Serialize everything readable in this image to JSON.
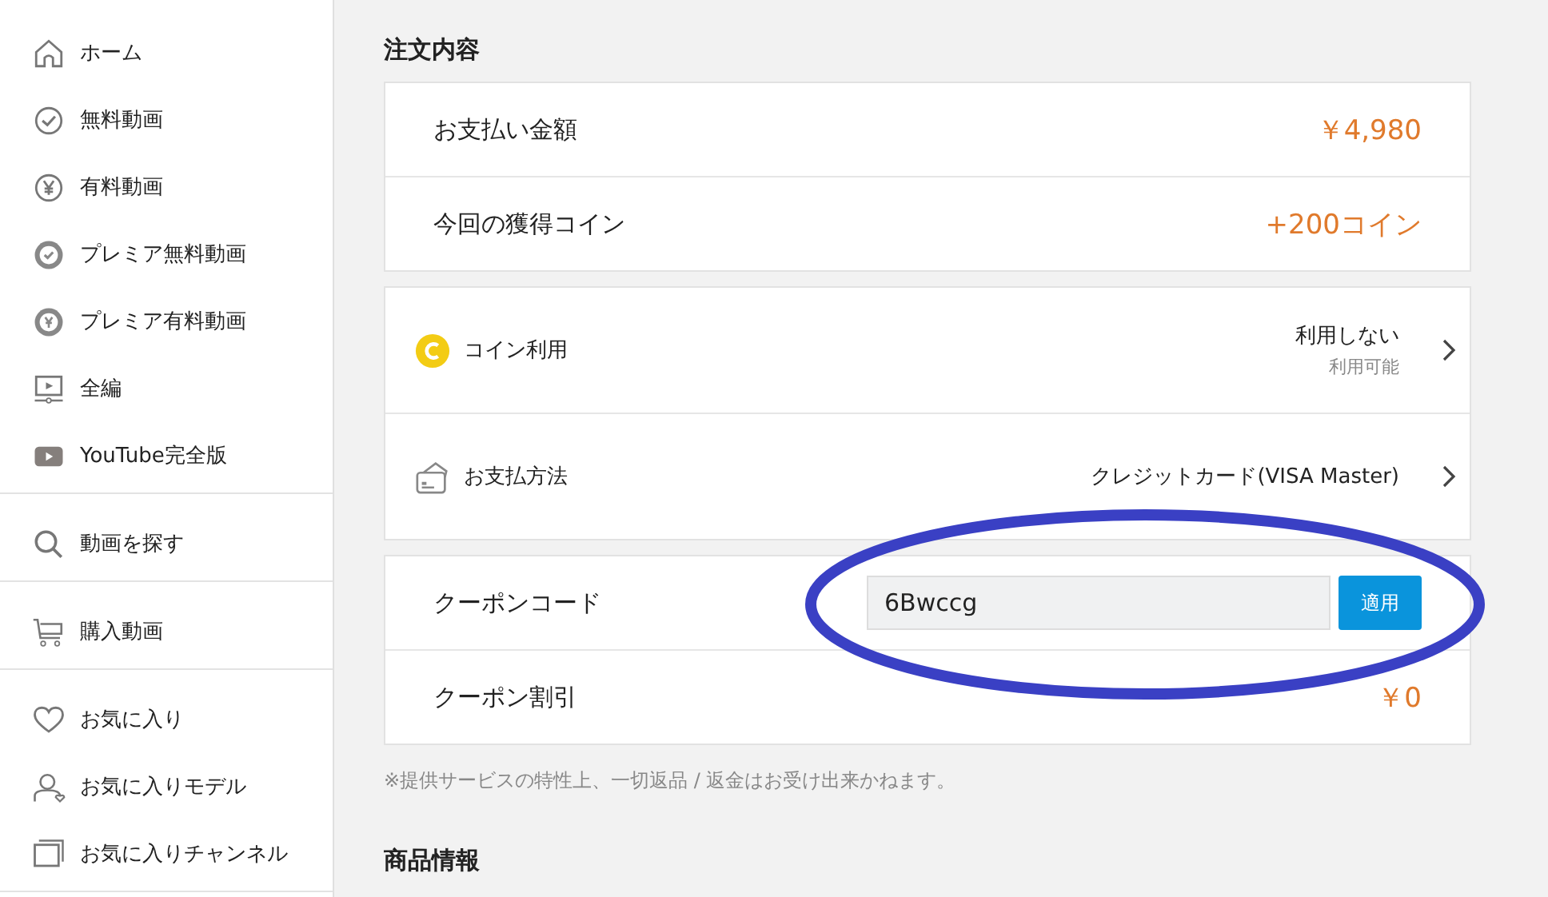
{
  "sidebar": {
    "groups": [
      {
        "items": [
          {
            "label": "ホーム",
            "kind": "home"
          },
          {
            "label": "無料動画",
            "kind": "check"
          },
          {
            "label": "有料動画",
            "kind": "yen"
          },
          {
            "label": "プレミア無料動画",
            "kind": "premium-check"
          },
          {
            "label": "プレミア有料動画",
            "kind": "premium-yen"
          },
          {
            "label": "全編",
            "kind": "video"
          },
          {
            "label": "YouTube完全版",
            "kind": "youtube"
          }
        ]
      },
      {
        "items": [
          {
            "label": "動画を探す",
            "kind": "search"
          }
        ]
      },
      {
        "items": [
          {
            "label": "購入動画",
            "kind": "cart"
          }
        ]
      },
      {
        "items": [
          {
            "label": "お気に入り",
            "kind": "heart"
          },
          {
            "label": "お気に入りモデル",
            "kind": "person"
          },
          {
            "label": "お気に入りチャンネル",
            "kind": "channel"
          }
        ]
      }
    ]
  },
  "order": {
    "title": "注文内容",
    "cards": [
      {
        "rows": [
          {
            "kind": "amount",
            "label": "お支払い金額",
            "value": "￥4,980"
          },
          {
            "kind": "amount",
            "label": "今回の獲得コイン",
            "value": "+200コイン"
          }
        ]
      },
      {
        "rows": [
          {
            "kind": "coin",
            "label": "コイン利用",
            "value": "利用しない",
            "sub": "利用可能"
          },
          {
            "kind": "payment",
            "label": "お支払方法",
            "value": "クレジットカード(VISA Master)"
          }
        ]
      },
      {
        "rows": [
          {
            "kind": "coupon",
            "label": "クーポンコード",
            "value": "6Bwccg",
            "button": "適用"
          },
          {
            "kind": "amount",
            "label": "クーポン割引",
            "value": "￥0"
          }
        ]
      }
    ],
    "note": "※提供サービスの特性上、一切返品 / 返金はお受け出来かねます。"
  },
  "product": {
    "title": "商品情報"
  },
  "annotations": [
    {
      "kind": "ellipse",
      "color": "#3a40c4"
    }
  ]
}
